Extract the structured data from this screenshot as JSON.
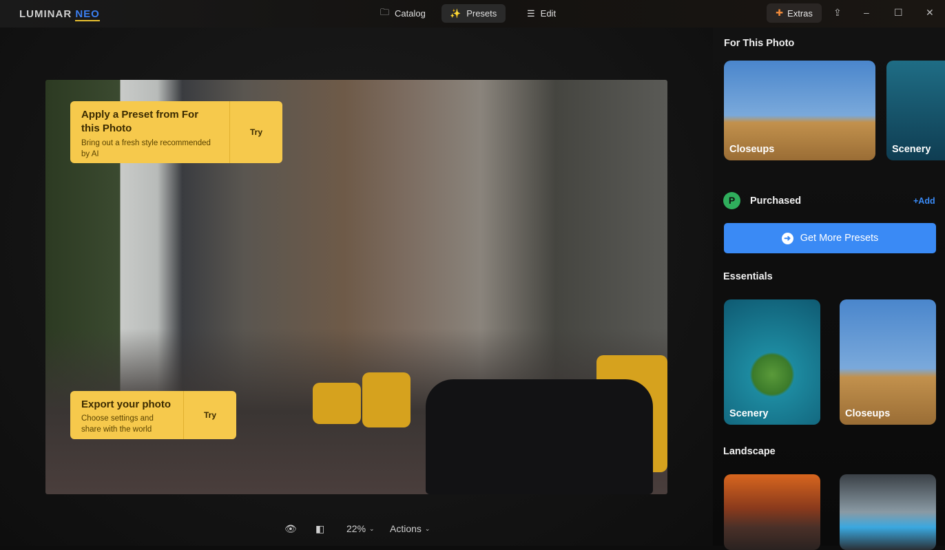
{
  "app": {
    "logo_main": "LUMINAR",
    "logo_accent": "NEO"
  },
  "nav": {
    "catalog": "Catalog",
    "presets": "Presets",
    "edit": "Edit",
    "extras": "Extras"
  },
  "tips": [
    {
      "title": "Apply a Preset from For this Photo",
      "desc": "Bring out a fresh style recommended by AI",
      "action": "Try"
    },
    {
      "title": "Export your photo",
      "desc": "Choose settings and share with the world",
      "action": "Try"
    }
  ],
  "bottom": {
    "zoom": "22%",
    "actions": "Actions"
  },
  "sidebar": {
    "for_this_photo": "For This Photo",
    "for_this_photo_items": [
      "Closeups",
      "Scenery"
    ],
    "purchased": "Purchased",
    "add": "+Add",
    "get_more": "Get More Presets",
    "essentials": "Essentials",
    "essentials_items": [
      "Scenery",
      "Closeups"
    ],
    "landscape": "Landscape"
  },
  "colors": {
    "accent": "#3a8af5",
    "tip": "#f6c94c"
  }
}
